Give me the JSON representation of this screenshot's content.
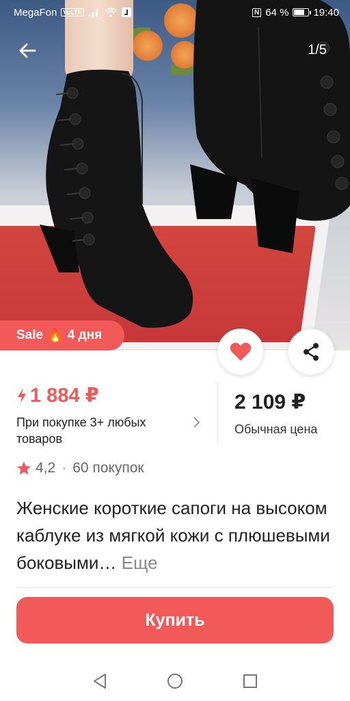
{
  "status_bar": {
    "carrier": "MegaFon",
    "volte": "VoLTE",
    "nfc": "N",
    "battery": "64 %",
    "battery_level": 0.64,
    "time": "19:40"
  },
  "gallery": {
    "counter": "1/5"
  },
  "badges": {
    "sale_label": "Sale",
    "sale_emoji": "🔥",
    "sale_duration": "4 дня"
  },
  "price": {
    "promo_price": "1 884 ₽",
    "promo_condition": "При покупке 3+ любых товаров",
    "regular_price": "2 109 ₽",
    "regular_label": "Обычная цена"
  },
  "rating": {
    "value": "4,2",
    "separator": "·",
    "purchases": "60 покупок"
  },
  "product": {
    "title": "Женские короткие сапоги на высоком каблуке из мягкой кожи с плюшевыми боковыми…",
    "more_label": "Еще"
  },
  "actions": {
    "buy_label": "Купить"
  },
  "colors": {
    "accent": "#f25a5a"
  }
}
